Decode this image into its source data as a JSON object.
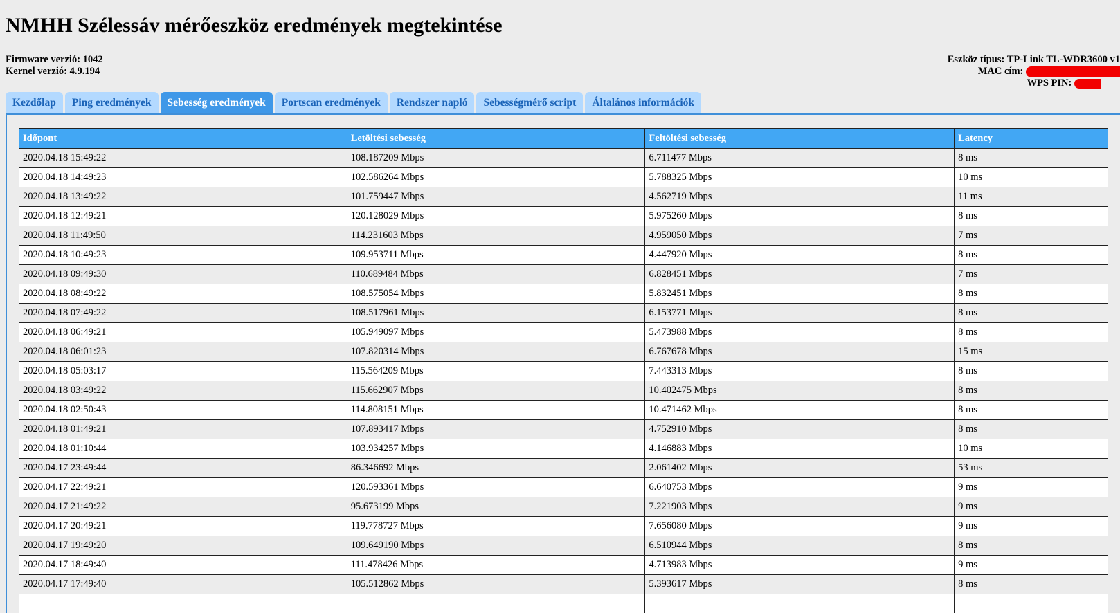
{
  "page_title": "NMHH Szélessáv mérőeszköz eredmények megtekintése",
  "firmware": {
    "label": "Firmware verzió:",
    "value": "1042"
  },
  "kernel": {
    "label": "Kernel verzió:",
    "value": "4.9.194"
  },
  "device_type": {
    "label": "Eszköz típus:",
    "value": "TP-Link TL-WDR3600 v1"
  },
  "mac": {
    "label": "MAC cím:"
  },
  "wps": {
    "label": "WPS PIN:"
  },
  "redaction_color": "#f20000",
  "tabs": [
    {
      "label": "Kezdőlap",
      "active": false
    },
    {
      "label": "Ping eredmények",
      "active": false
    },
    {
      "label": "Sebesség eredmények",
      "active": true
    },
    {
      "label": "Portscan eredmények",
      "active": false
    },
    {
      "label": "Rendszer napló",
      "active": false
    },
    {
      "label": "Sebességmérő script",
      "active": false
    },
    {
      "label": "Általános információk",
      "active": false
    }
  ],
  "table": {
    "headers": [
      "Időpont",
      "Letöltési sebesség",
      "Feltöltési sebesség",
      "Latency"
    ],
    "rows": [
      [
        "2020.04.18 15:49:22",
        "108.187209 Mbps",
        "6.711477 Mbps",
        "8 ms"
      ],
      [
        "2020.04.18 14:49:23",
        "102.586264 Mbps",
        "5.788325 Mbps",
        "10 ms"
      ],
      [
        "2020.04.18 13:49:22",
        "101.759447 Mbps",
        "4.562719 Mbps",
        "11 ms"
      ],
      [
        "2020.04.18 12:49:21",
        "120.128029 Mbps",
        "5.975260 Mbps",
        "8 ms"
      ],
      [
        "2020.04.18 11:49:50",
        "114.231603 Mbps",
        "4.959050 Mbps",
        "7 ms"
      ],
      [
        "2020.04.18 10:49:23",
        "109.953711 Mbps",
        "4.447920 Mbps",
        "8 ms"
      ],
      [
        "2020.04.18 09:49:30",
        "110.689484 Mbps",
        "6.828451 Mbps",
        "7 ms"
      ],
      [
        "2020.04.18 08:49:22",
        "108.575054 Mbps",
        "5.832451 Mbps",
        "8 ms"
      ],
      [
        "2020.04.18 07:49:22",
        "108.517961 Mbps",
        "6.153771 Mbps",
        "8 ms"
      ],
      [
        "2020.04.18 06:49:21",
        "105.949097 Mbps",
        "5.473988 Mbps",
        "8 ms"
      ],
      [
        "2020.04.18 06:01:23",
        "107.820314 Mbps",
        "6.767678 Mbps",
        "15 ms"
      ],
      [
        "2020.04.18 05:03:17",
        "115.564209 Mbps",
        "7.443313 Mbps",
        "8 ms"
      ],
      [
        "2020.04.18 03:49:22",
        "115.662907 Mbps",
        "10.402475 Mbps",
        "8 ms"
      ],
      [
        "2020.04.18 02:50:43",
        "114.808151 Mbps",
        "10.471462 Mbps",
        "8 ms"
      ],
      [
        "2020.04.18 01:49:21",
        "107.893417 Mbps",
        "4.752910 Mbps",
        "8 ms"
      ],
      [
        "2020.04.18 01:10:44",
        "103.934257 Mbps",
        "4.146883 Mbps",
        "10 ms"
      ],
      [
        "2020.04.17 23:49:44",
        "86.346692 Mbps",
        "2.061402 Mbps",
        "53 ms"
      ],
      [
        "2020.04.17 22:49:21",
        "120.593361 Mbps",
        "6.640753 Mbps",
        "9 ms"
      ],
      [
        "2020.04.17 21:49:22",
        "95.673199 Mbps",
        "7.221903 Mbps",
        "9 ms"
      ],
      [
        "2020.04.17 20:49:21",
        "119.778727 Mbps",
        "7.656080 Mbps",
        "9 ms"
      ],
      [
        "2020.04.17 19:49:20",
        "109.649190 Mbps",
        "6.510944 Mbps",
        "8 ms"
      ],
      [
        "2020.04.17 18:49:40",
        "111.478426 Mbps",
        "4.713983 Mbps",
        "9 ms"
      ],
      [
        "2020.04.17 17:49:40",
        "105.512862 Mbps",
        "5.393617 Mbps",
        "8 ms"
      ],
      [
        "",
        "",
        "",
        ""
      ]
    ]
  }
}
